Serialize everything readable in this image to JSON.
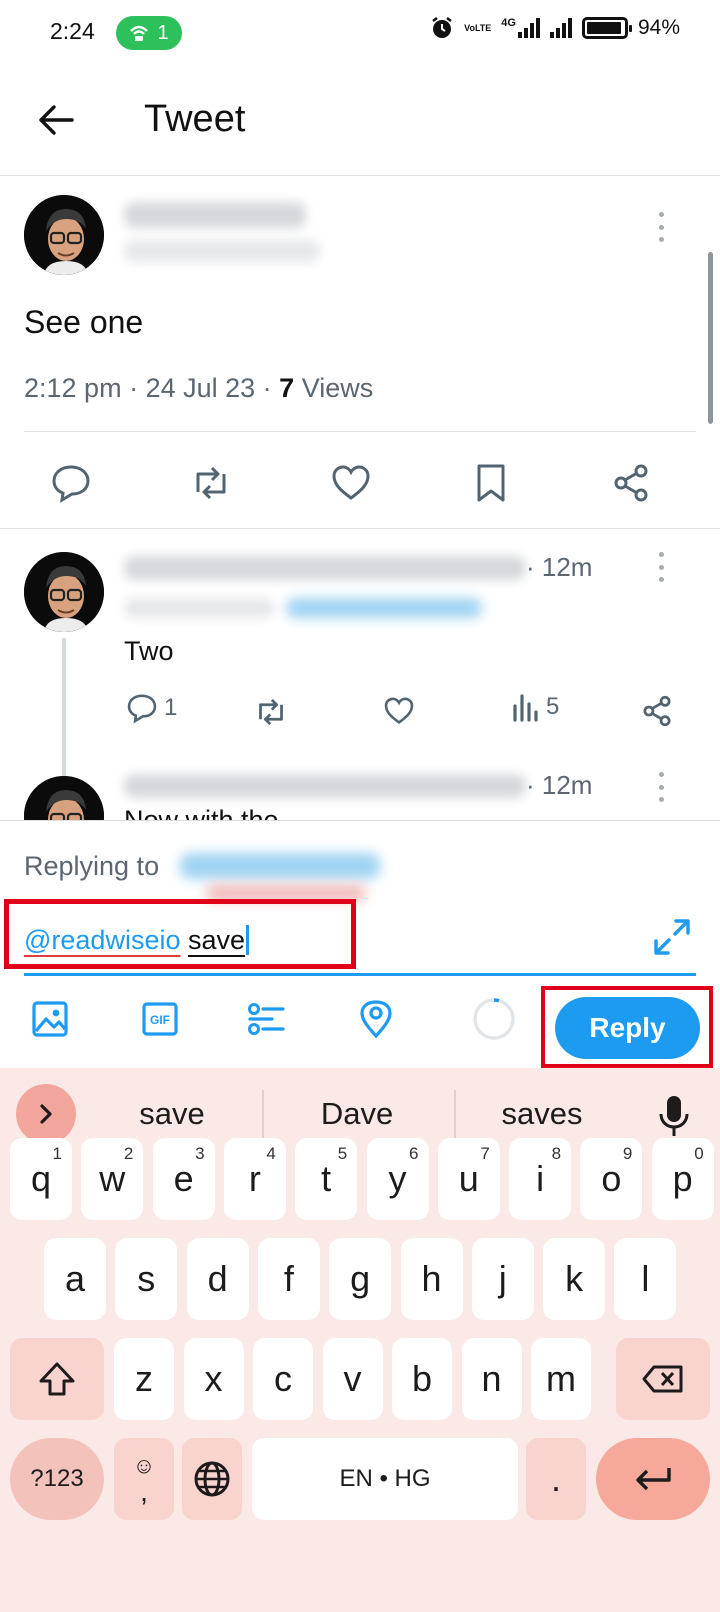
{
  "status": {
    "time": "2:24",
    "hotspot_count": "1",
    "network": "4G",
    "volte": "VoLTE",
    "battery": "94%",
    "battery_level": 0.94
  },
  "header": {
    "title": "Tweet"
  },
  "tweet": {
    "text": "See one",
    "time": "2:12 pm",
    "date": "24 Jul 23",
    "views_count": "7",
    "views_label": "Views"
  },
  "replies": [
    {
      "time": "· 12m",
      "text": "Two",
      "reply_count": "1",
      "view_count": "5"
    },
    {
      "time": "· 12m",
      "text": "Now with the"
    }
  ],
  "composer": {
    "replying_label": "Replying to",
    "mention": "@readwiseio",
    "text": "save",
    "reply_button": "Reply"
  },
  "keyboard": {
    "suggestions": [
      "save",
      "Dave",
      "saves"
    ],
    "row1": [
      {
        "k": "q",
        "n": "1"
      },
      {
        "k": "w",
        "n": "2"
      },
      {
        "k": "e",
        "n": "3"
      },
      {
        "k": "r",
        "n": "4"
      },
      {
        "k": "t",
        "n": "5"
      },
      {
        "k": "y",
        "n": "6"
      },
      {
        "k": "u",
        "n": "7"
      },
      {
        "k": "i",
        "n": "8"
      },
      {
        "k": "o",
        "n": "9"
      },
      {
        "k": "p",
        "n": "0"
      }
    ],
    "row2": [
      "a",
      "s",
      "d",
      "f",
      "g",
      "h",
      "j",
      "k",
      "l"
    ],
    "row3": [
      "z",
      "x",
      "c",
      "v",
      "b",
      "n",
      "m"
    ],
    "symbols_key": "?123",
    "comma_key": ",",
    "space_key": "EN • HG",
    "period_key": "."
  },
  "colors": {
    "accent": "#1d9bf0",
    "highlight": "#e0001a",
    "keyboard_bg": "#fbe9e7"
  }
}
